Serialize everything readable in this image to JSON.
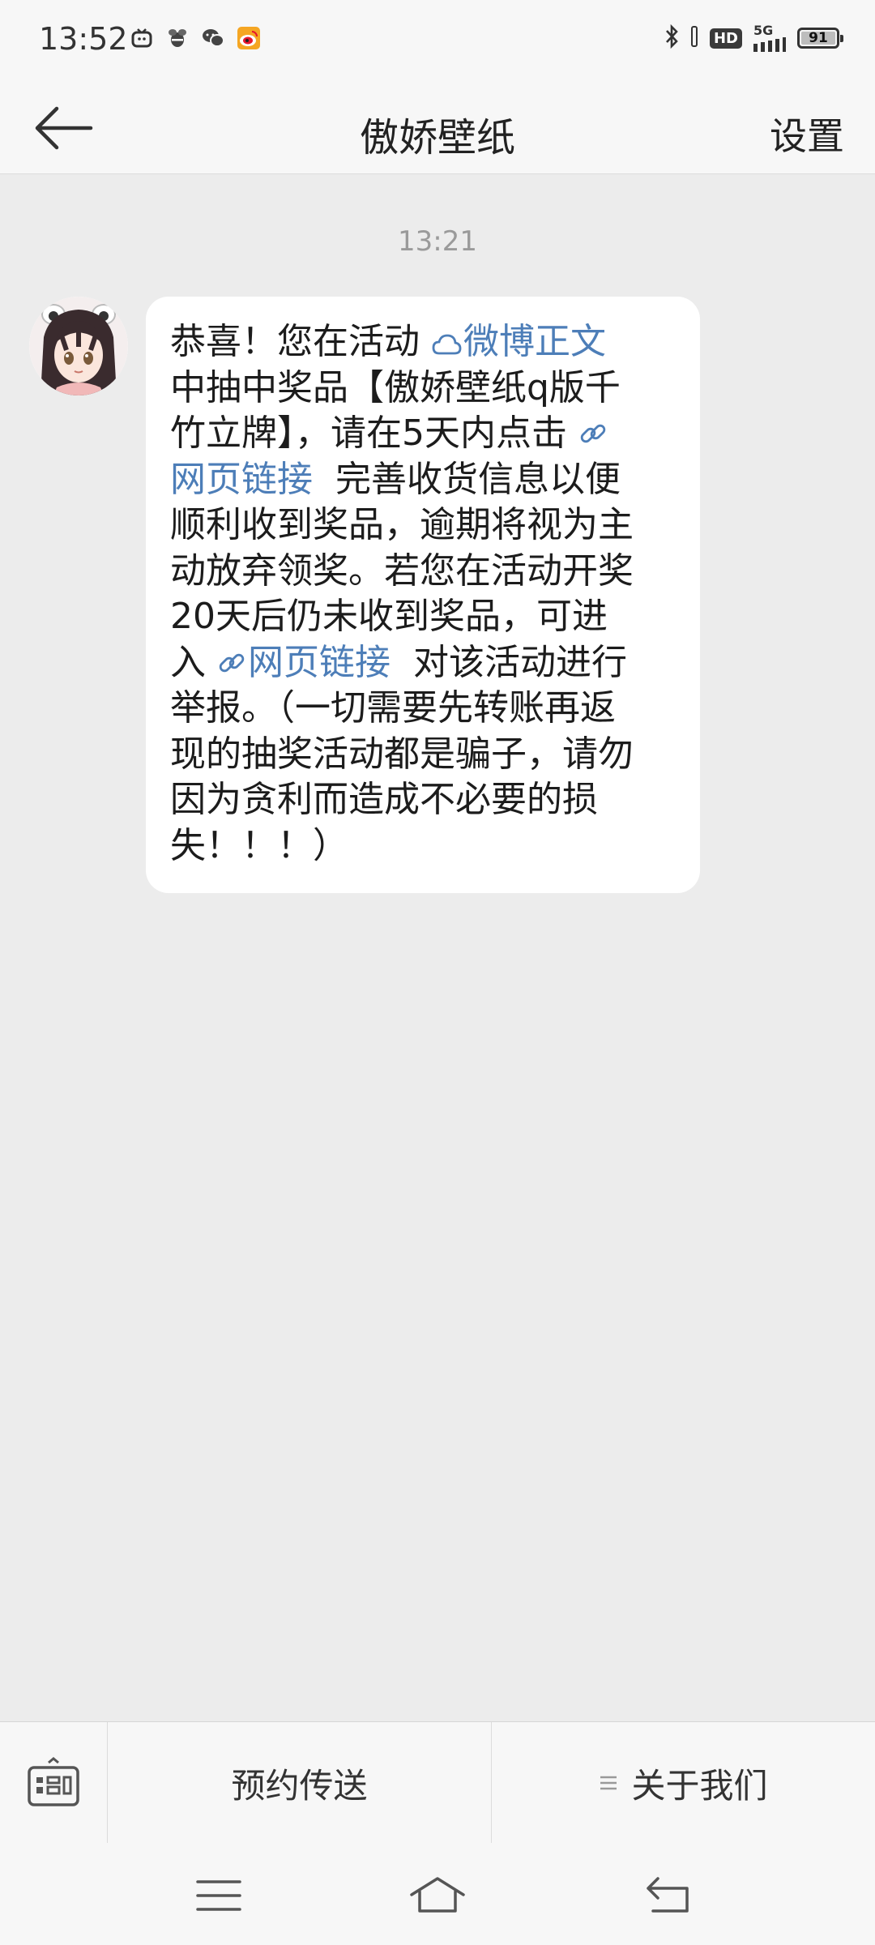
{
  "status_bar": {
    "time": "13:52",
    "app_icons": [
      "tv-app-icon",
      "bee-app-icon",
      "wechat-icon",
      "weibo-icon"
    ],
    "hd_label": "HD",
    "network_label": "5G",
    "battery_level": "91",
    "battery_fraction": 0.91
  },
  "header": {
    "title": "傲娇壁纸",
    "settings_label": "设置"
  },
  "chat": {
    "timestamp": "13:21",
    "message": {
      "l1_text": "恭喜！您在活动 ",
      "l1_link": "微博正文",
      "l2": "中抽中奖品【傲娇壁纸q版千",
      "l3_text": "竹立牌】，请在5天内点击 ",
      "l4_link": "网页链接",
      "l4_text": "  完善收货信息以便",
      "l5": "顺利收到奖品，逾期将视为主",
      "l6": "动放弃领奖。若您在活动开奖",
      "l7": "20天后仍未收到奖品，可进",
      "l8_text": "入 ",
      "l8_link": "网页链接",
      "l8_tail": "  对该活动进行",
      "l9": "举报。（一切需要先转账再返",
      "l10": "现的抽奖活动都是骗子，请勿",
      "l11": "因为贪利而造成不必要的损",
      "l12": "失！！！）"
    }
  },
  "bottom_menu": {
    "schedule_label": "预约传送",
    "about_label": "关于我们"
  },
  "colors": {
    "link": "#4d7eb8",
    "background": "#ececec",
    "bubble": "#ffffff"
  }
}
